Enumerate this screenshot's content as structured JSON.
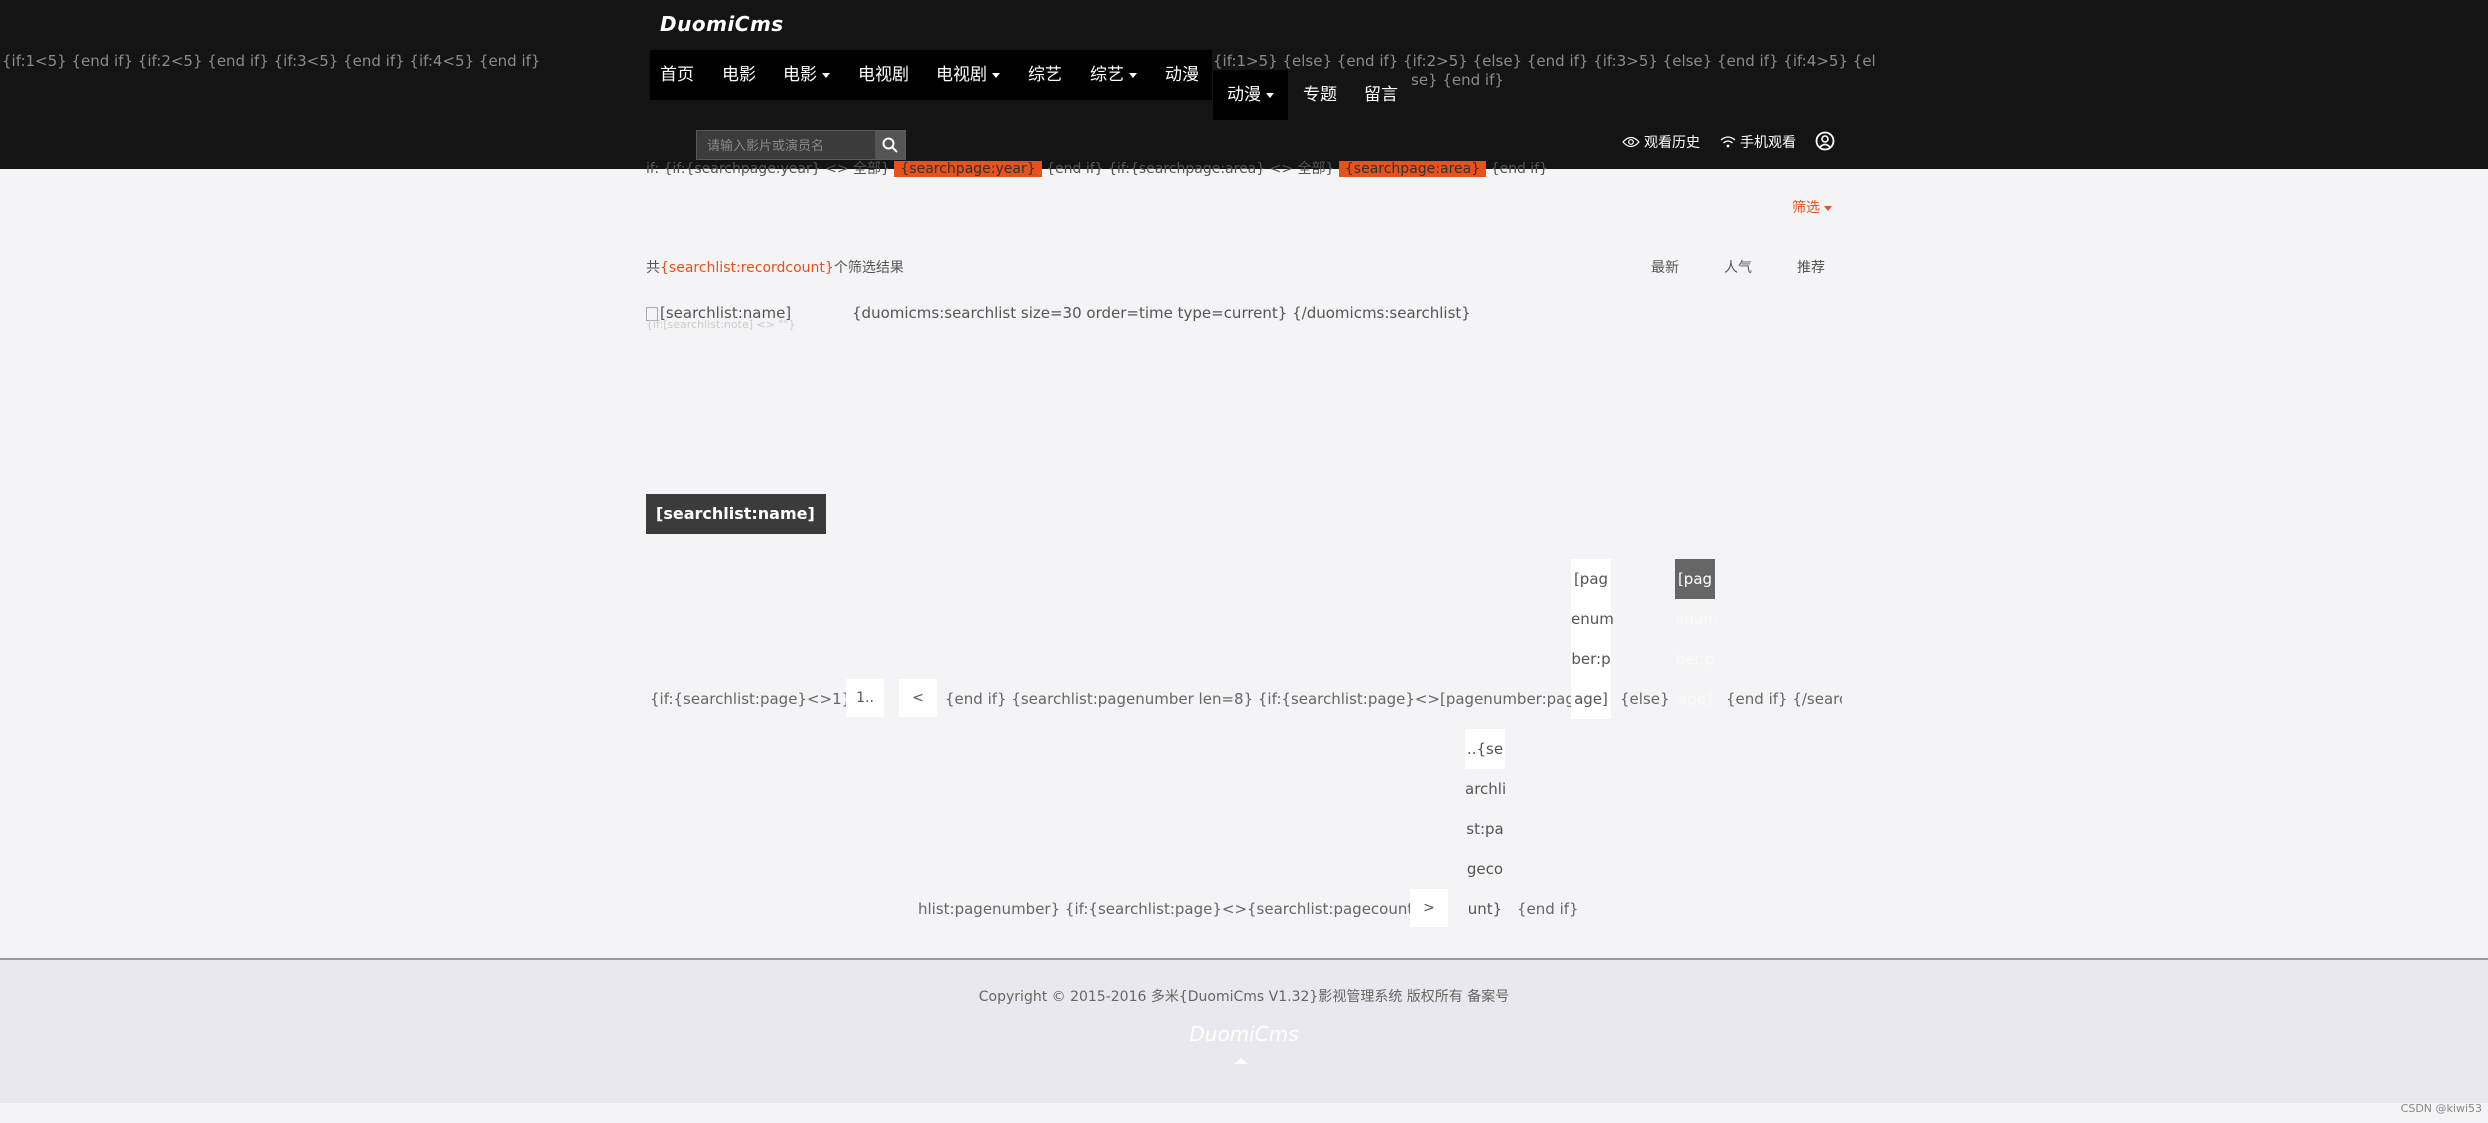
{
  "header": {
    "logo": "DuomiCms",
    "tpl_left": "{if:1<5} {end if} {if:2<5} {end if} {if:3<5} {end if} {if:4<5} {end if}",
    "tpl_right_line1": "{if:1>5} {else} {end if} {if:2>5} {else} {end if} {if:3>5} {else} {end if} {if:4>5} {el",
    "tpl_right_line2": "se} {end if}",
    "nav": {
      "home": "首页",
      "movie": "电影",
      "movie_dd": "电影",
      "tv": "电视剧",
      "tv_dd": "电视剧",
      "variety": "综艺",
      "variety_dd": "综艺",
      "anime": "动漫",
      "anime_dd": "动漫",
      "topic": "专题",
      "message": "留言"
    },
    "search_placeholder": "请输入影片或演员名",
    "history": "观看历史",
    "mobile": "手机观看"
  },
  "filter": {
    "crumb_tpl1": "if: {if:{searchpage:year} <> 全部} ",
    "crumb_tag1": "{searchpage:year}",
    "crumb_tpl2": " {end if} {if:{searchpage:area} <> 全部} ",
    "crumb_tag2": "{searchpage:area}",
    "crumb_tpl3": " {end if}",
    "button": "筛选"
  },
  "results": {
    "prefix": "共",
    "count": "{searchlist:recordcount}",
    "suffix": "个筛选结果",
    "sort_latest": "最新",
    "sort_popular": "人气",
    "sort_recommend": "推荐",
    "thumb_alt": "[searchlist:name]",
    "thumb_note": "{if:[searchlist:note] <> \"\"}",
    "list_tpl": "{duomicms:searchlist size=30 order=time type=current} {/duomicms:searchlist}",
    "name_tab": "[searchlist:name]"
  },
  "pagination": {
    "tpl_start": "{if:{searchlist:page}<>1}",
    "first": "1..",
    "prev": "<",
    "tpl_mid": "{end if} {searchlist:pagenumber len=8} {if:{searchlist:page}<>[pagenumber:page]}",
    "page_a": [
      "[pag",
      "enum",
      "ber:p",
      "age]"
    ],
    "tpl_else": "{else}",
    "page_b": [
      "[pag",
      "enum",
      "ber:p",
      "age]"
    ],
    "tpl_end": "{end if} {/searc",
    "last_stack": [
      "..{se",
      "archli",
      "st:pa",
      "geco",
      "unt}"
    ],
    "tpl_line2": "hlist:pagenumber} {if:{searchlist:page}<>{searchlist:pagecount}}",
    "next": ">",
    "tpl_endif2": "{end if}"
  },
  "footer": {
    "copyright": "Copyright © 2015-2016 多米{DuomiCms V1.32}影视管理系统 版权所有 备案号",
    "logo": "DuomiCms",
    "watermark": "CSDN @kiwi53"
  }
}
